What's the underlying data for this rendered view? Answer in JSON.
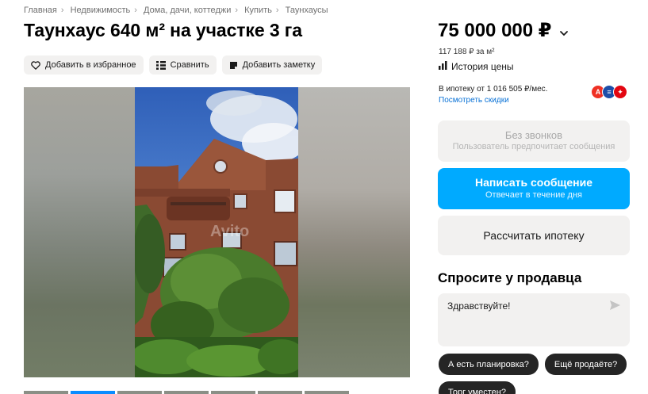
{
  "breadcrumb": [
    "Главная",
    "Недвижимость",
    "Дома, дачи, коттеджи",
    "Купить",
    "Таунхаусы"
  ],
  "title": "Таунхаус 640 м² на участке 3 га",
  "actions": {
    "favorite": "Добавить в избранное",
    "compare": "Сравнить",
    "note": "Добавить заметку"
  },
  "gallery": {
    "watermark": "Avito",
    "thumb_count": 7,
    "active_thumb": 1
  },
  "price": {
    "value": "75 000 000 ₽",
    "per_meter": "117 188 ₽ за м²",
    "history_label": "История цены"
  },
  "mortgage": {
    "text": "В ипотеку от 1 016 505 ₽/мес.",
    "discounts_link": "Посмотреть скидки",
    "banks": [
      {
        "icon": "alfa-bank-logo",
        "letter": "А",
        "color": "#ef3124"
      },
      {
        "icon": "bank-stripes-logo",
        "letter": "≡",
        "color": "#1d4ea8"
      },
      {
        "icon": "mts-bank-logo",
        "letter": "✦",
        "color": "#e30611"
      }
    ]
  },
  "contact": {
    "no_calls": {
      "title": "Без звонков",
      "subtitle": "Пользователь предпочитает сообщения"
    },
    "write": {
      "title": "Написать сообщение",
      "subtitle": "Отвечает в течение дня"
    },
    "calc_mortgage": "Рассчитать ипотеку"
  },
  "ask": {
    "title": "Спросите у продавца",
    "message_value": "Здравствуйте!",
    "quick_questions": [
      "А есть планировка?",
      "Ещё продаёте?",
      "Торг уместен?"
    ]
  },
  "colors": {
    "accent": "#00aaff",
    "link": "#0a72d6",
    "chip_bg": "#252525",
    "button_bg": "#f2f1f0"
  }
}
